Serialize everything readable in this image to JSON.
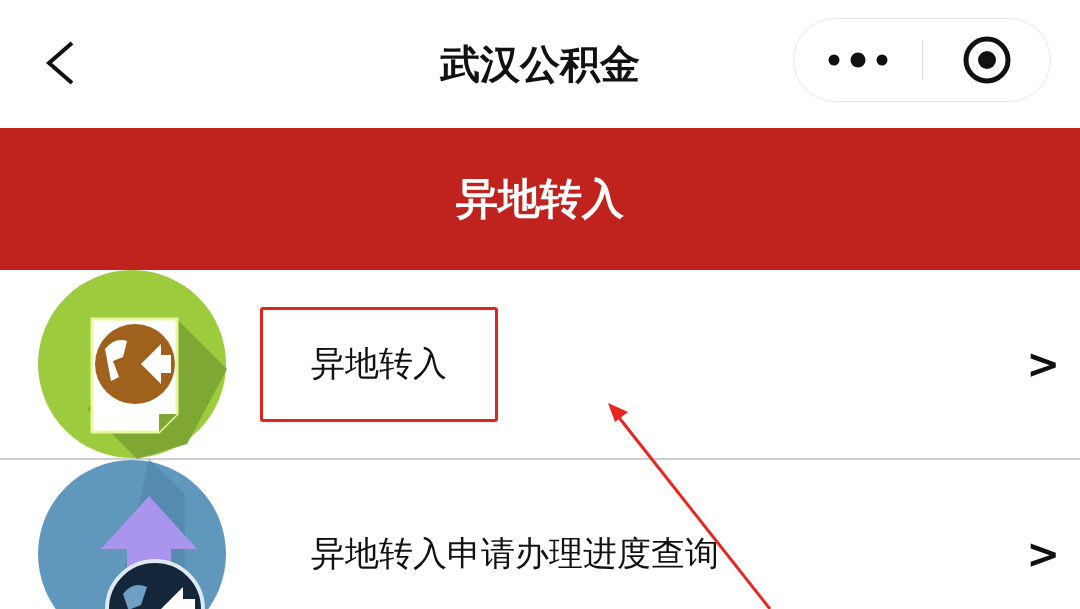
{
  "nav_bar": {
    "title": "武汉公积金"
  },
  "banner": {
    "title": "异地转入"
  },
  "menu_items": [
    {
      "kind": "document",
      "label": "异地转入",
      "chevron": ">",
      "highlighted": true
    },
    {
      "kind": "upload",
      "label": "异地转入申请办理进度查询",
      "chevron": ">",
      "highlighted": false
    }
  ]
}
